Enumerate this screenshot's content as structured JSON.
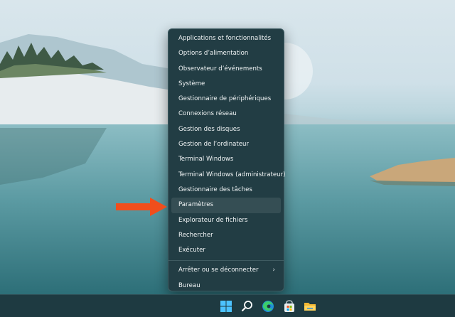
{
  "menu": {
    "items": [
      {
        "label": "Applications et fonctionnalités"
      },
      {
        "label": "Options d’alimentation"
      },
      {
        "label": "Observateur d’événements"
      },
      {
        "label": "Système"
      },
      {
        "label": "Gestionnaire de périphériques"
      },
      {
        "label": "Connexions réseau"
      },
      {
        "label": "Gestion des disques"
      },
      {
        "label": "Gestion de l’ordinateur"
      },
      {
        "label": "Terminal Windows"
      },
      {
        "label": "Terminal Windows (administrateur)"
      },
      {
        "label": "Gestionnaire des tâches"
      },
      {
        "label": "Paramètres"
      },
      {
        "label": "Explorateur de fichiers"
      },
      {
        "label": "Rechercher"
      },
      {
        "label": "Exécuter"
      },
      {
        "label": "Arrêter ou se déconnecter"
      },
      {
        "label": "Bureau"
      }
    ],
    "highlighted": "Paramètres",
    "submenu_chevron": "›"
  },
  "annotation": {
    "arrow_color": "#f04e1c"
  },
  "taskbar": {
    "icons": [
      "windows-start-icon",
      "search-icon",
      "edge-browser-icon",
      "microsoft-store-icon",
      "file-explorer-icon"
    ]
  }
}
